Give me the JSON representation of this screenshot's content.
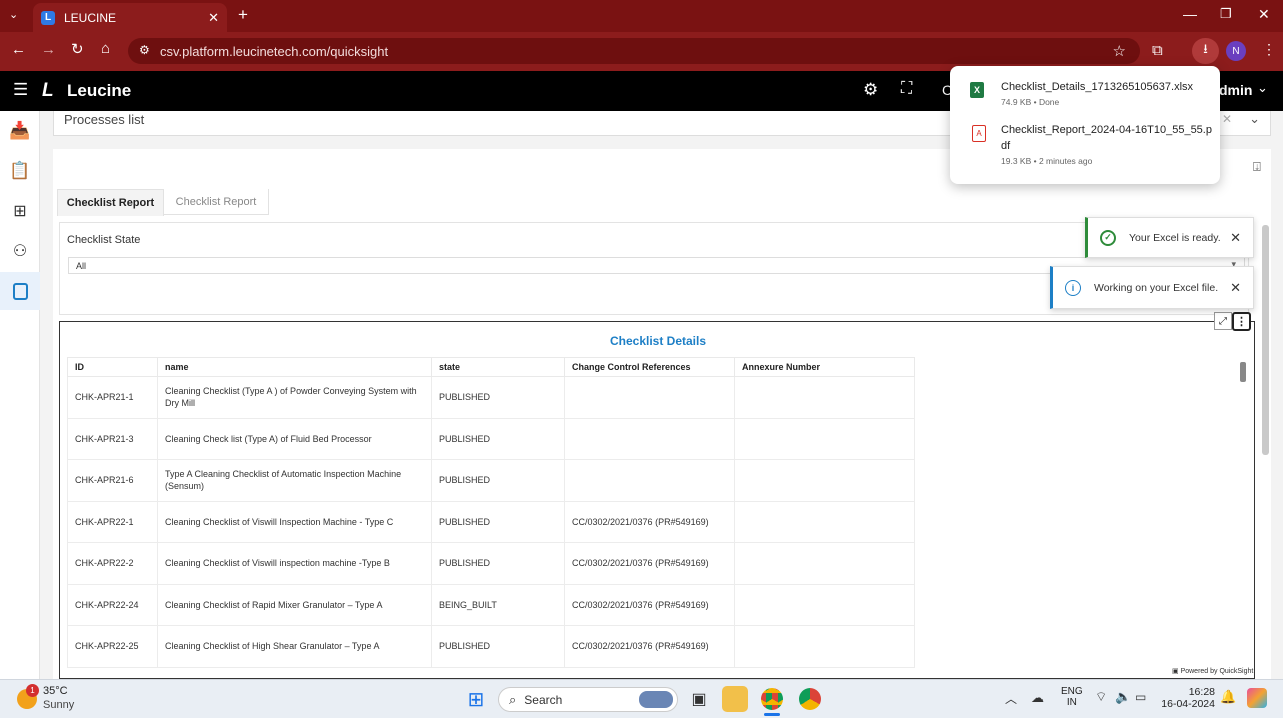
{
  "browser": {
    "tab_title": "LEUCINE",
    "tab_favicon": "L",
    "url": "csv.platform.leucinetech.com/quicksight",
    "profile_initial": "N"
  },
  "app": {
    "logo_text": "Leucine",
    "header_partial_text": "C",
    "user_partial": "dmin"
  },
  "process_select": {
    "value": "Processes list"
  },
  "tabs": [
    {
      "label": "Checklist Report",
      "active": true
    },
    {
      "label": "Checklist Report",
      "active": false
    }
  ],
  "filter": {
    "label": "Checklist State",
    "value": "All"
  },
  "visual": {
    "title": "Checklist Details",
    "columns": [
      "ID",
      "name",
      "state",
      "Change Control References",
      "Annexure Number"
    ],
    "rows": [
      {
        "id": "CHK-APR21-1",
        "name": "Cleaning Checklist (Type A ) of Powder Conveying System with Dry Mill",
        "state": "PUBLISHED",
        "ccr": "",
        "annex": ""
      },
      {
        "id": "CHK-APR21-3",
        "name": "Cleaning Check list (Type A) of Fluid Bed Processor",
        "state": "PUBLISHED",
        "ccr": "",
        "annex": ""
      },
      {
        "id": "CHK-APR21-6",
        "name": "Type A Cleaning Checklist of Automatic Inspection Machine (Sensum)",
        "state": "PUBLISHED",
        "ccr": "",
        "annex": ""
      },
      {
        "id": "CHK-APR22-1",
        "name": "Cleaning Checklist of Viswill Inspection Machine - Type C",
        "state": "PUBLISHED",
        "ccr": "CC/0302/2021/0376 (PR#549169)",
        "annex": ""
      },
      {
        "id": "CHK-APR22-2",
        "name": "Cleaning Checklist of Viswill inspection machine -Type B",
        "state": "PUBLISHED",
        "ccr": "CC/0302/2021/0376 (PR#549169)",
        "annex": ""
      },
      {
        "id": "CHK-APR22-24",
        "name": "Cleaning Checklist of Rapid Mixer Granulator – Type A",
        "state": "BEING_BUILT",
        "ccr": "CC/0302/2021/0376 (PR#549169)",
        "annex": ""
      },
      {
        "id": "CHK-APR22-25",
        "name": "Cleaning Checklist of High Shear Granulator – Type A",
        "state": "PUBLISHED",
        "ccr": "CC/0302/2021/0376 (PR#549169)",
        "annex": ""
      }
    ],
    "powered_by": "Powered by QuickSight"
  },
  "downloads": [
    {
      "name": "Checklist_Details_1713265105637.xlsx",
      "meta": "74.9 KB • Done",
      "type": "excel"
    },
    {
      "name_line1": "Checklist_Report_2024-04-16T10_55_55.p",
      "name_line2": "df",
      "meta": "19.3 KB • 2 minutes ago",
      "type": "pdf"
    }
  ],
  "toasts": [
    {
      "text": "Your Excel is ready.",
      "kind": "success"
    },
    {
      "text": "Working on your Excel file.",
      "kind": "info"
    }
  ],
  "taskbar": {
    "weather_temp": "35°C",
    "weather_desc": "Sunny",
    "weather_badge": "1",
    "search_label": "Search",
    "lang1": "ENG",
    "lang2": "IN",
    "time": "16:28",
    "date": "16-04-2024"
  },
  "colors": {
    "accent_blue": "#1d7fc6",
    "browser_red": "#8c1c1c",
    "success_green": "#2e8b3a"
  }
}
